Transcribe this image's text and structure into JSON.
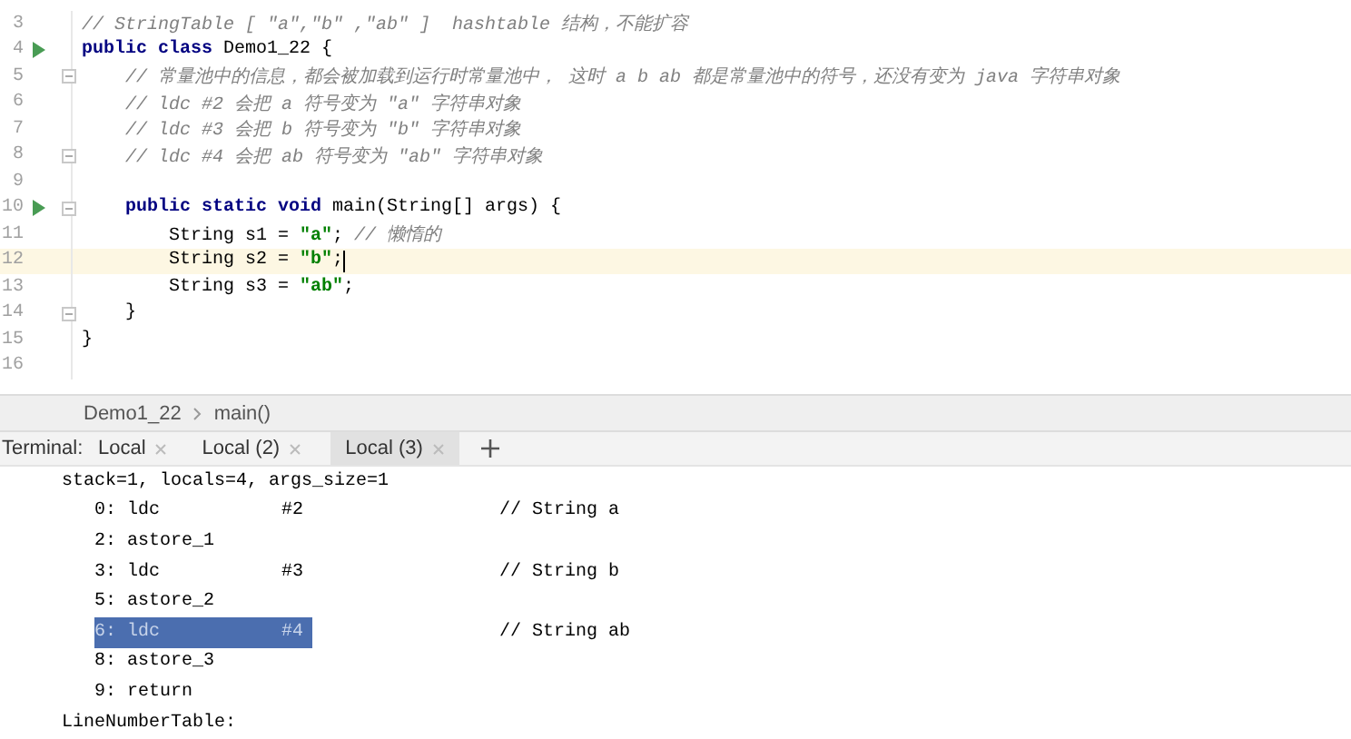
{
  "editor": {
    "lines": [
      {
        "number": "3",
        "run": false,
        "fold": false,
        "current": false,
        "kind": "top",
        "tokens": [
          {
            "kind": "comment",
            "text": "// StringTable [ \"a\",\"b\" ,\"ab\" ]  hashtable 结构，不能扩容"
          }
        ]
      },
      {
        "number": "4",
        "run": true,
        "fold": false,
        "current": false,
        "kind": "top",
        "tokens": [
          {
            "kind": "keyword",
            "text": "public class "
          },
          {
            "kind": "plain",
            "text": "Demo1_22 {"
          }
        ]
      },
      {
        "number": "5",
        "run": false,
        "fold": true,
        "current": false,
        "kind": "member",
        "tokens": [
          {
            "kind": "comment",
            "text": "// 常量池中的信息，都会被加载到运行时常量池中， 这时 a b ab 都是常量池中的符号，还没有变为 java 字符串对象"
          }
        ]
      },
      {
        "number": "6",
        "run": false,
        "fold": false,
        "current": false,
        "kind": "member",
        "tokens": [
          {
            "kind": "comment",
            "text": "// ldc #2 会把 a 符号变为 \"a\" 字符串对象"
          }
        ]
      },
      {
        "number": "7",
        "run": false,
        "fold": false,
        "current": false,
        "kind": "member",
        "tokens": [
          {
            "kind": "comment",
            "text": "// ldc #3 会把 b 符号变为 \"b\" 字符串对象"
          }
        ]
      },
      {
        "number": "8",
        "run": false,
        "fold": true,
        "current": false,
        "kind": "member",
        "tokens": [
          {
            "kind": "comment",
            "text": "// ldc #4 会把 ab 符号变为 \"ab\" 字符串对象"
          }
        ]
      },
      {
        "number": "9",
        "run": false,
        "fold": false,
        "current": false,
        "kind": "top"
      },
      {
        "number": "10",
        "run": true,
        "fold": true,
        "current": false,
        "kind": "member",
        "tokens": [
          {
            "kind": "keyword",
            "text": "public static void "
          },
          {
            "kind": "plain",
            "text": "main(String[] args) {"
          }
        ]
      },
      {
        "number": "11",
        "run": false,
        "fold": false,
        "current": false,
        "kind": "body",
        "tokens": [
          {
            "kind": "plain",
            "text": "String s1 = "
          },
          {
            "kind": "string",
            "text": "\"a\""
          },
          {
            "kind": "plain",
            "text": "; "
          },
          {
            "kind": "comment",
            "text": "// 懒惰的"
          }
        ]
      },
      {
        "number": "12",
        "run": false,
        "fold": false,
        "current": true,
        "kind": "body",
        "tokens": [
          {
            "kind": "plain",
            "text": "String s2 = "
          },
          {
            "kind": "string",
            "text": "\"b\""
          },
          {
            "kind": "plain",
            "text": ";"
          }
        ]
      },
      {
        "number": "13",
        "run": false,
        "fold": false,
        "current": false,
        "kind": "body",
        "tokens": [
          {
            "kind": "plain",
            "text": "String s3 = "
          },
          {
            "kind": "string",
            "text": "\"ab\""
          },
          {
            "kind": "plain",
            "text": ";"
          }
        ]
      },
      {
        "number": "14",
        "run": false,
        "fold": true,
        "current": false,
        "kind": "member",
        "tokens": [
          {
            "kind": "plain",
            "text": "}"
          }
        ]
      },
      {
        "number": "15",
        "run": false,
        "fold": false,
        "current": false,
        "kind": "top",
        "tokens": [
          {
            "kind": "plain",
            "text": "}"
          }
        ]
      },
      {
        "number": "16",
        "run": false,
        "fold": false,
        "current": false,
        "kind": "top"
      }
    ]
  },
  "breadcrumb": [
    "Demo1_22",
    "main()"
  ],
  "terminal": {
    "label": "Terminal:",
    "tabs": [
      {
        "label": "Local",
        "selected": false
      },
      {
        "label": "Local (2)",
        "selected": false
      },
      {
        "label": "Local (3)",
        "selected": true
      }
    ],
    "lines": [
      {
        "kind": "header",
        "text": "stack=1, locals=4, args_size=1"
      },
      {
        "kind": "instr",
        "op": "0: ldc",
        "arg": "#2",
        "comment": "// String a",
        "selected": false
      },
      {
        "kind": "instr",
        "op": "2: astore_1",
        "selected": false
      },
      {
        "kind": "instr",
        "op": "3: ldc",
        "arg": "#3",
        "comment": "// String b",
        "selected": false
      },
      {
        "kind": "instr",
        "op": "5: astore_2",
        "selected": false
      },
      {
        "kind": "instr",
        "op": "6: ldc",
        "arg": "#4",
        "comment": "// String ab",
        "selected": true
      },
      {
        "kind": "instr",
        "op": "8: astore_3",
        "selected": false
      },
      {
        "kind": "instr",
        "op": "9: return",
        "selected": false
      },
      {
        "kind": "header",
        "text": "LineNumberTable:"
      }
    ]
  }
}
